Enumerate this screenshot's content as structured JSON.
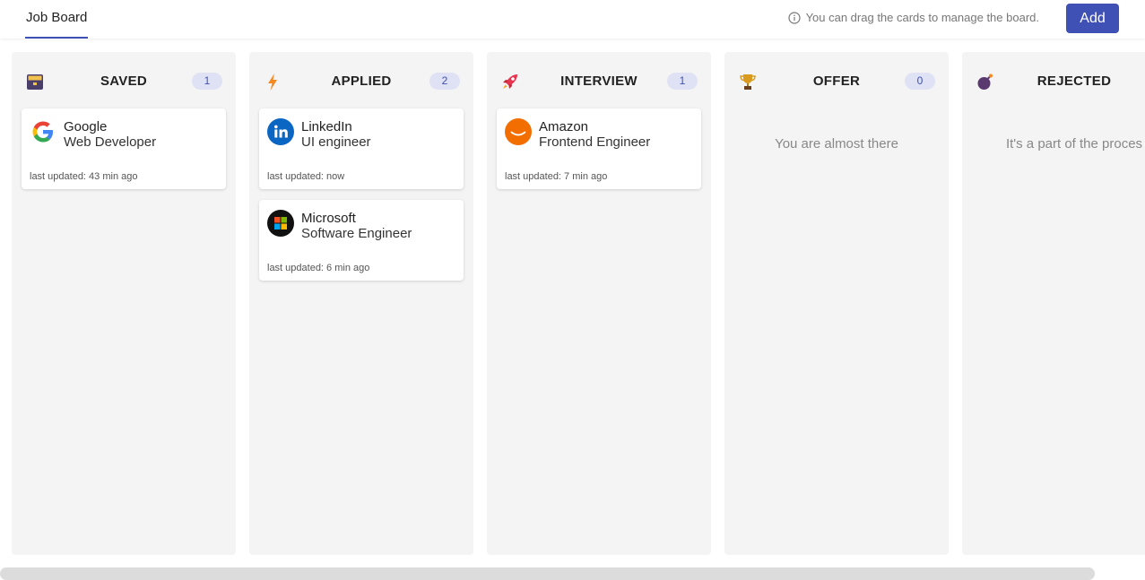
{
  "header": {
    "tab_label": "Job Board",
    "hint": "You can drag the cards to manage the board.",
    "add_label": "Add"
  },
  "columns": [
    {
      "title": "SAVED",
      "count": "1",
      "icon": "archive-icon",
      "cards": [
        {
          "company": "Google",
          "role": "Web Developer",
          "updated": "last updated: 43 min ago",
          "logo": "google-logo"
        }
      ]
    },
    {
      "title": "APPLIED",
      "count": "2",
      "icon": "lightning-icon",
      "cards": [
        {
          "company": "LinkedIn",
          "role": "UI engineer",
          "updated": "last updated: now",
          "logo": "linkedin-logo"
        },
        {
          "company": "Microsoft",
          "role": "Software Engineer",
          "updated": "last updated: 6 min ago",
          "logo": "microsoft-logo"
        }
      ]
    },
    {
      "title": "INTERVIEW",
      "count": "1",
      "icon": "rocket-icon",
      "cards": [
        {
          "company": "Amazon",
          "role": "Frontend Engineer",
          "updated": "last updated: 7 min ago",
          "logo": "amazon-logo"
        }
      ]
    },
    {
      "title": "OFFER",
      "count": "0",
      "icon": "trophy-icon",
      "empty_text": "You are almost there",
      "cards": []
    },
    {
      "title": "REJECTED",
      "count": "",
      "icon": "bomb-icon",
      "empty_text": "It's a part of the proces",
      "cards": []
    }
  ],
  "colors": {
    "accent": "#3f51b5",
    "column_bg": "#f4f4f4",
    "badge_bg": "#dfe2f4"
  }
}
